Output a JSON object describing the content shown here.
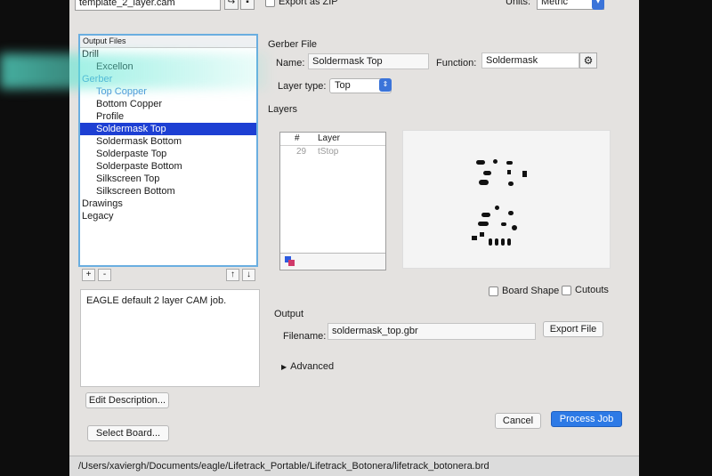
{
  "toolbar": {
    "file_combo": "template_2_layer.cam",
    "export_zip_label": "Export as ZIP",
    "units_label": "Units:",
    "units_value": "Metric"
  },
  "tree": {
    "header": "Output Files",
    "items": [
      {
        "label": "Drill",
        "level": 0
      },
      {
        "label": "Excellon",
        "level": 1
      },
      {
        "label": "Gerber",
        "level": 0
      },
      {
        "label": "Top Copper",
        "level": 1
      },
      {
        "label": "Bottom Copper",
        "level": 1
      },
      {
        "label": "Profile",
        "level": 1
      },
      {
        "label": "Soldermask Top",
        "level": 1
      },
      {
        "label": "Soldermask Bottom",
        "level": 1
      },
      {
        "label": "Solderpaste Top",
        "level": 1
      },
      {
        "label": "Solderpaste Bottom",
        "level": 1
      },
      {
        "label": "Silkscreen Top",
        "level": 1
      },
      {
        "label": "Silkscreen Bottom",
        "level": 1
      },
      {
        "label": "Drawings",
        "level": 0
      },
      {
        "label": "Legacy",
        "level": 0
      }
    ],
    "buttons": {
      "add": "+",
      "remove": "-",
      "up": "↑",
      "down": "↓"
    }
  },
  "description": "EAGLE default 2 layer CAM job.",
  "left_buttons": {
    "edit_description": "Edit Description...",
    "select_board": "Select Board..."
  },
  "gerber": {
    "section_title": "Gerber File",
    "name_label": "Name:",
    "name_value": "Soldermask Top",
    "function_label": "Function:",
    "function_value": "Soldermask",
    "layer_type_label": "Layer type:",
    "layer_type_value": "Top"
  },
  "layers": {
    "section_title": "Layers",
    "col_num": "#",
    "col_layer": "Layer",
    "rows": [
      {
        "num": "29",
        "name": "tStop"
      }
    ]
  },
  "options": {
    "board_shape_label": "Board Shape",
    "cutouts_label": "Cutouts"
  },
  "output": {
    "section_title": "Output",
    "filename_label": "Filename:",
    "filename_value": "soldermask_top.gbr",
    "export_file_label": "Export File",
    "advanced_label": "Advanced"
  },
  "actions": {
    "cancel": "Cancel",
    "process_job": "Process Job"
  },
  "status_path": "/Users/xaviergh/Documents/eagle/Lifetrack_Portable/Lifetrack_Botonera/lifetrack_botonera.brd",
  "colors": {
    "selection": "#1d3fd3",
    "primary_button": "#2d7ae6",
    "tree_blue": "#4a90d9",
    "focus_border": "#6aaee0"
  }
}
